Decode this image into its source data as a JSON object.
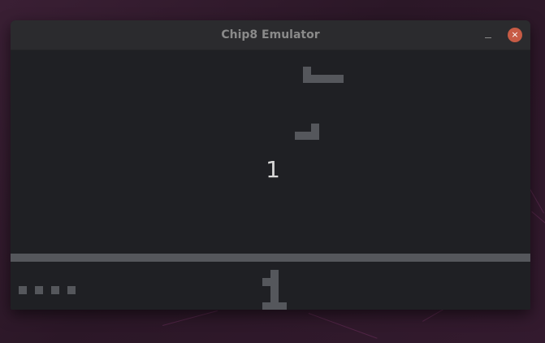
{
  "window": {
    "title": "Chip8 Emulator",
    "minimize_icon": "minimize-icon",
    "close_icon": "close-icon",
    "close_glyph": "×"
  },
  "game": {
    "countdown_label": "1",
    "score_glyph": "1",
    "lives_remaining": 4,
    "pixel_color": "#55575c",
    "screen_color": "#1f2024"
  }
}
